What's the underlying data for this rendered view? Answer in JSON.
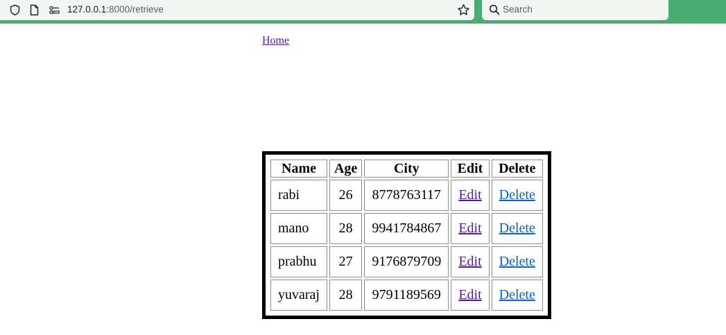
{
  "browser": {
    "url_host": "127.0.0.1:",
    "url_path": "8000/retrieve",
    "search_placeholder": "Search"
  },
  "page": {
    "home_link": "Home"
  },
  "table": {
    "headers": [
      "Name",
      "Age",
      "City",
      "Edit",
      "Delete"
    ],
    "rows": [
      {
        "name": "rabi",
        "age": "26",
        "city": "8778763117",
        "edit": "Edit",
        "delete": "Delete"
      },
      {
        "name": "mano",
        "age": "28",
        "city": "9941784867",
        "edit": "Edit",
        "delete": "Delete"
      },
      {
        "name": "prabhu",
        "age": "27",
        "city": "9176879709",
        "edit": "Edit",
        "delete": "Delete"
      },
      {
        "name": "yuvaraj",
        "age": "28",
        "city": "9791189569",
        "edit": "Edit",
        "delete": "Delete"
      }
    ]
  },
  "colors": {
    "chrome_accent": "#4aac73",
    "visited_link": "#551a8b",
    "link": "#0b62b7"
  },
  "icons": {
    "shield": "shield-icon",
    "page": "page-icon",
    "permissions": "permissions-icon",
    "bookmark": "star-icon",
    "search": "search-icon"
  }
}
